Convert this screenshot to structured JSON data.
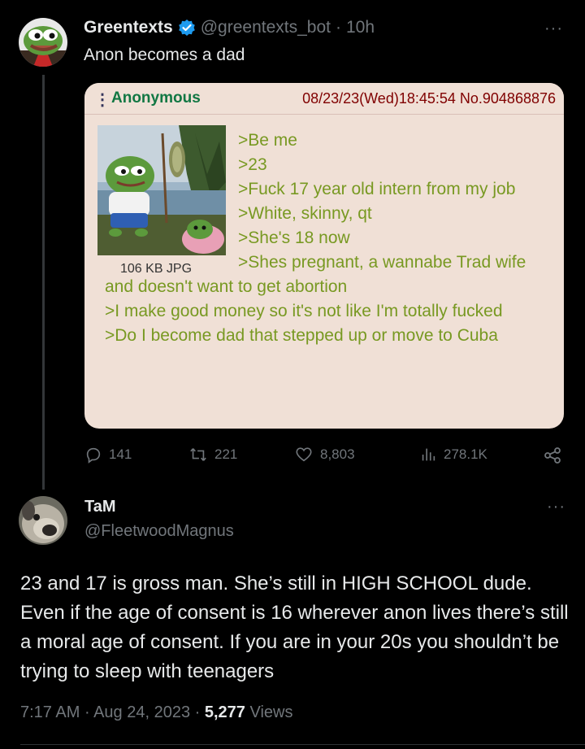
{
  "tweet": {
    "display_name": "Greentexts",
    "handle": "@greentexts_bot",
    "time": "10h",
    "text": "Anon becomes a dad",
    "more": "···",
    "avatar_icon": "pepe-frog-avatar"
  },
  "card": {
    "menu": "⋮",
    "poster_name": "Anonymous",
    "post_meta": "08/23/23(Wed)18:45:54 No.904868876",
    "file_size": "106 KB JPG",
    "lines": [
      ">Be me",
      ">23",
      ">Fuck 17 year old intern from my job",
      ">White, skinny, qt",
      ">She's 18 now",
      ">Shes pregnant, a wannabe Trad wife and doesn't want to get abortion",
      ">I make good money so it's not like I'm totally fucked",
      ">Do I become dad that stepped up or move to Cuba"
    ],
    "colors": {
      "background": "#f0e0d6",
      "greentext": "#789922",
      "name": "#117743",
      "meta": "#800000"
    }
  },
  "actions": {
    "replies": "141",
    "reposts": "221",
    "likes": "8,803",
    "views": "278.1K"
  },
  "reply": {
    "display_name": "TaM",
    "handle": "@FleetwoodMagnus",
    "more": "···",
    "text": "23 and 17 is gross man. She’s still in HIGH SCHOOL dude. Even if the age of consent is 16 wherever anon lives there’s still a moral age of consent. If you are in your 20s you shouldn’t be trying to sleep with teenagers",
    "time": "7:17 AM",
    "date": "Aug 24, 2023",
    "views_count": "5,277",
    "views_label": "Views"
  }
}
